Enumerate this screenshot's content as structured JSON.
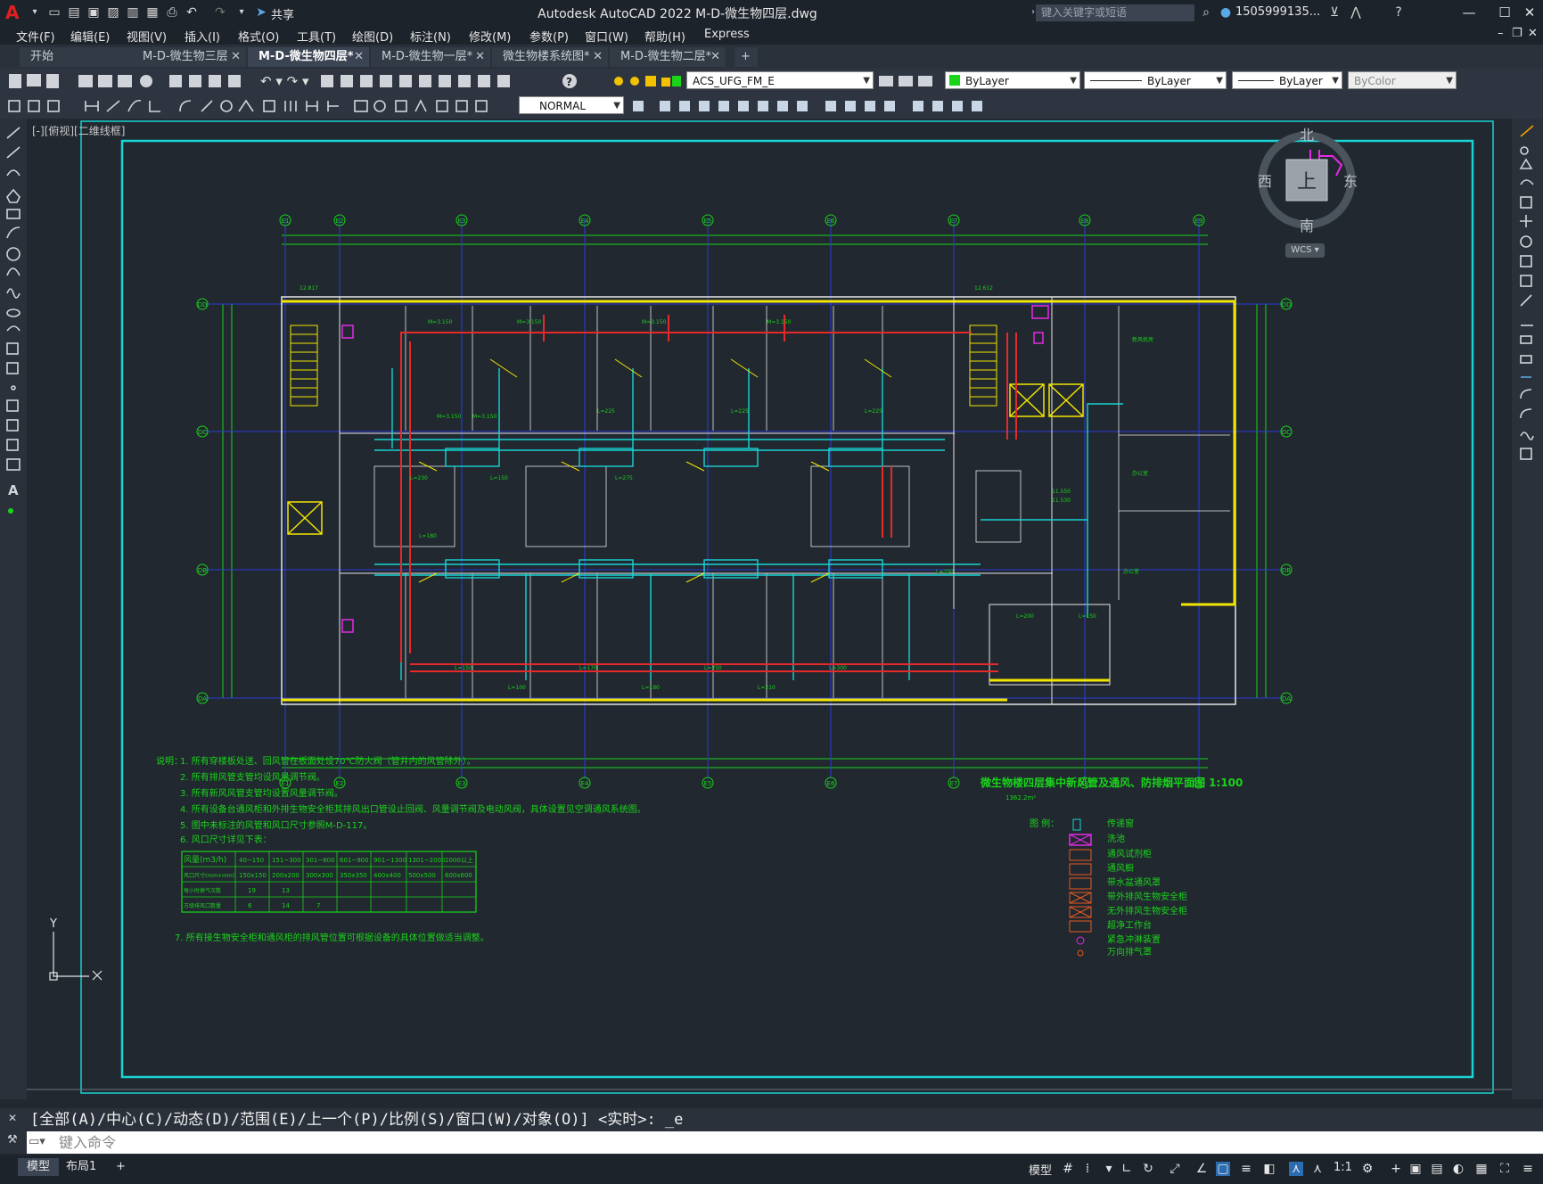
{
  "app": {
    "title": "Autodesk AutoCAD 2022    M-D-微生物四层.dwg",
    "search_placeholder": "键入关键字或短语",
    "user": "1505999135...",
    "share_label": "共享"
  },
  "menu": [
    "文件(F)",
    "编辑(E)",
    "视图(V)",
    "插入(I)",
    "格式(O)",
    "工具(T)",
    "绘图(D)",
    "标注(N)",
    "修改(M)",
    "参数(P)",
    "窗口(W)",
    "帮助(H)",
    "Express"
  ],
  "tabs": [
    {
      "label": "开始",
      "closable": false,
      "active": false
    },
    {
      "label": "M-D-微生物三层",
      "closable": true,
      "active": false
    },
    {
      "label": "M-D-微生物四层*",
      "closable": true,
      "active": true
    },
    {
      "label": "M-D-微生物一层*",
      "closable": true,
      "active": false
    },
    {
      "label": "微生物楼系统图*",
      "closable": true,
      "active": false
    },
    {
      "label": "M-D-微生物二层*",
      "closable": true,
      "active": false
    }
  ],
  "toolbar": {
    "layer": "ACS_UFG_FM_E",
    "color": "ByLayer",
    "linetype": "ByLayer",
    "lineweight": "ByLayer",
    "plotstyle": "ByColor",
    "textstyle": "NORMAL"
  },
  "viewport_label": "[-][俯视][二维线框]",
  "viewcube": {
    "north": "北",
    "south": "南",
    "east": "东",
    "west": "西",
    "face": "上",
    "wcs": "WCS"
  },
  "ucs": {
    "x": "X",
    "y": "Y"
  },
  "drawing": {
    "grid_top": [
      "E1",
      "E2",
      "E3",
      "E4",
      "E5",
      "E6",
      "E7",
      "E8",
      "E9"
    ],
    "grid_side": [
      "DD",
      "DC",
      "DB",
      "DA"
    ],
    "title": "微生物楼四层集中新风管及通风、防排烟平面图  1:100",
    "area": "1362.2m²",
    "notes_title": "说明：",
    "notes": [
      "1. 所有穿楼板处送、回风管在板面处设70℃防火阀（管井内的风管除外）。",
      "2. 所有排风管支管均设风量调节阀。",
      "3. 所有新风风管支管均设置风量调节阀。",
      "4. 所有设备台通风柜和外排生物安全柜其排风出口管设止回阀、风量调节阀及电动风阀，具体设置见空调通风系统图。",
      "5. 图中未标注的风管和风口尺寸参照M-D-117。",
      "6. 风口尺寸详见下表：",
      "7. 所有接生物安全柜和通风柜的排风管位置可根据设备的具体位置做适当调整。"
    ],
    "table": {
      "headers": [
        "风量(m3/h)",
        "40~150",
        "151~300",
        "301~600",
        "601~900",
        "901~1300",
        "1301~2000",
        "2000以上"
      ],
      "rows": [
        [
          "风口尺寸(mm×mm)",
          "150x150",
          "200x200",
          "300x300",
          "350x350",
          "400x400",
          "500x500",
          "600x600"
        ],
        [
          "每小时换气次数",
          "19",
          "13",
          "",
          "",
          "",
          "",
          ""
        ],
        [
          "万级排风口数量",
          "6",
          "14",
          "7",
          "",
          "",
          "",
          ""
        ]
      ]
    },
    "legend_title": "图  例：",
    "legend": [
      "传递窗",
      "洗池",
      "通风试剂柜",
      "通风橱",
      "带水盆通风罩",
      "带外排风生物安全柜",
      "无外排风生物安全柜",
      "超净工作台",
      "紧急冲淋装置",
      "万向排气罩"
    ]
  },
  "command": {
    "history": "[全部(A)/中心(C)/动态(D)/范围(E)/上一个(P)/比例(S)/窗口(W)/对象(O)] <实时>: _e",
    "placeholder": "键入命令"
  },
  "status": {
    "tab_model": "模型",
    "tab_layout": "布局1",
    "model_label": "模型",
    "scale": "1:1"
  }
}
